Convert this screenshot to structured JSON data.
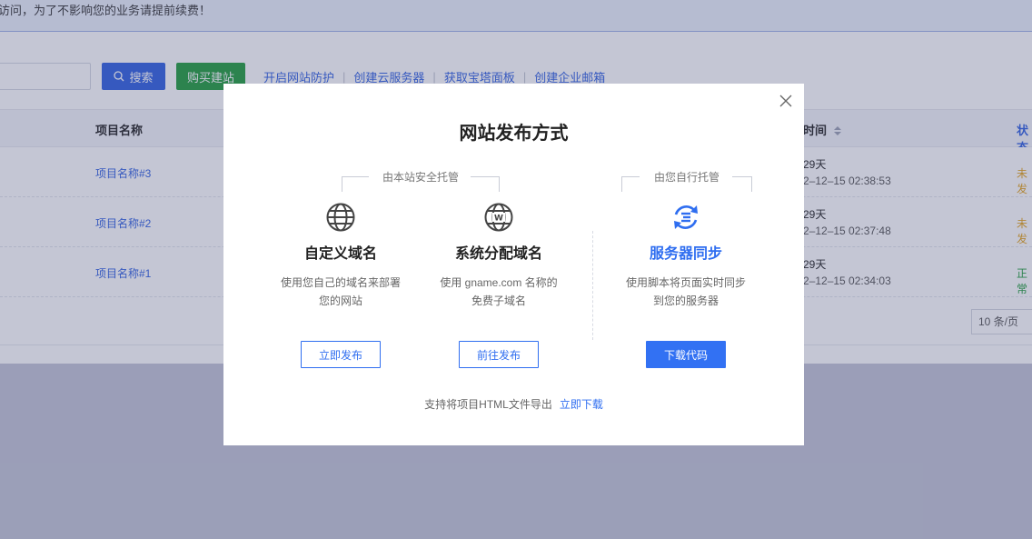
{
  "notice": {
    "text": "访问，为了不影响您的业务请提前续费！"
  },
  "toolbar": {
    "search_label": "搜索",
    "buy_label": "购买建站",
    "links": [
      "开启网站防护",
      "创建云服务器",
      "获取宝塔面板",
      "创建企业邮箱"
    ]
  },
  "table": {
    "headers": {
      "name": "项目名称",
      "time": "时间",
      "status": "状态"
    },
    "rows": [
      {
        "name": "项目名称#3",
        "days": "29天",
        "date": "2–12–15 02:38:53",
        "status": "未发",
        "status_color": "#e3a21a"
      },
      {
        "name": "项目名称#2",
        "days": "29天",
        "date": "2–12–15 02:37:48",
        "status": "未发",
        "status_color": "#e3a21a"
      },
      {
        "name": "项目名称#1",
        "days": "29天",
        "date": "2–12–15 02:34:03",
        "status": "正常",
        "status_color": "#1f9c3a"
      }
    ]
  },
  "pager": {
    "size": "10 条/页"
  },
  "modal": {
    "title": "网站发布方式",
    "group_hosted": "由本站安全托管",
    "group_self": "由您自行托管",
    "options": [
      {
        "icon": "globe-icon",
        "name": "自定义域名",
        "desc1": "使用您自己的域名来部署",
        "desc2": "您的网站",
        "button": "立即发布"
      },
      {
        "icon": "globe-w-icon",
        "name": "系统分配域名",
        "desc1": "使用 gname.com 名称的",
        "desc2": "免费子域名",
        "button": "前往发布"
      },
      {
        "icon": "sync-icon",
        "name": "服务器同步",
        "desc1": "使用脚本将页面实时同步",
        "desc2": "到您的服务器",
        "button": "下载代码"
      }
    ],
    "footer_text": "支持将项目HTML文件导出",
    "footer_link": "立即下载"
  },
  "colors": {
    "accent": "#2f6ef0",
    "primary_button": "#3271f3",
    "buy_button": "#1f9c3a"
  }
}
